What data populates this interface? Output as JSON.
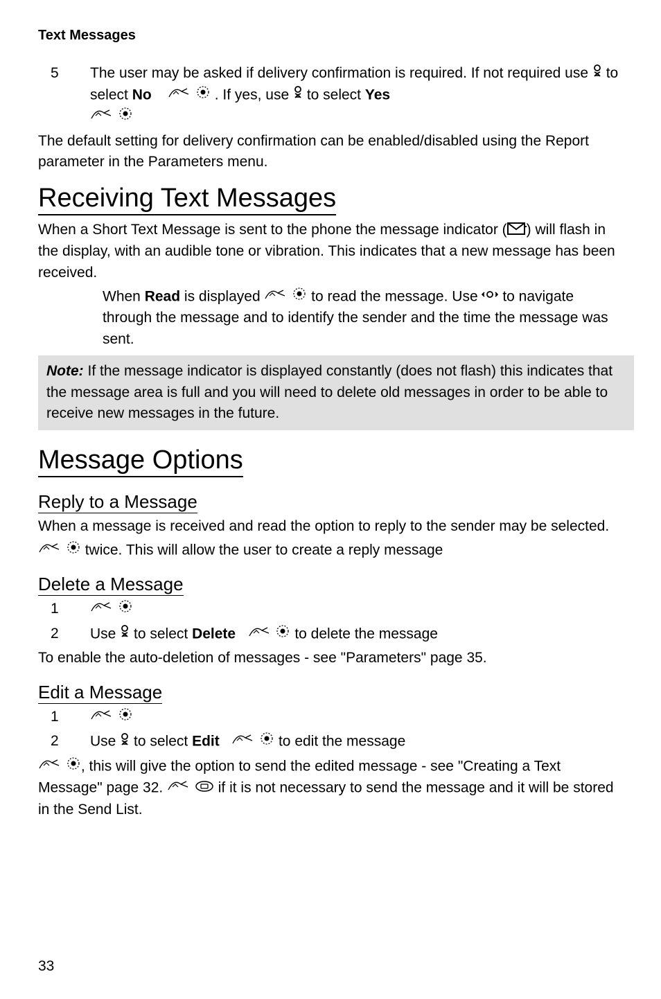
{
  "header": "Text Messages",
  "step5": {
    "num": "5",
    "text1": "The user may be asked if delivery confirmation is required. If not required use ",
    "text2": " to select ",
    "no": "No",
    "text3": ". If yes, use ",
    "text4": " to select ",
    "yes": "Yes"
  },
  "default_setting": "The default setting for delivery confirmation can be enabled/disabled using the Report parameter in the Parameters menu.",
  "h1_receiving": "Receiving Text Messages",
  "receiving": {
    "p1a": "When a Short Text Message is sent to the phone the message indicator (",
    "p1b": ") will flash in the display, with an audible tone or vibration. This indicates that a new message has been received.",
    "p2a": "When ",
    "read": "Read",
    "p2b": " is displayed ",
    "p2c": " to read the message. Use ",
    "p2d": " to navigate through the message and to identify the sender and the time the message was sent."
  },
  "note": {
    "label": "Note:",
    "text": " If the message indicator is displayed constantly (does not flash) this indicates that the message area is full and you will need to delete old messages in order to be able to receive new messages in the future."
  },
  "h1_options": "Message Options",
  "h2_reply": "Reply to a Message",
  "reply": {
    "p1": "When a message is received and read the option to reply to the sender may be selected.",
    "p2": " twice. This will allow the user to create a reply message"
  },
  "h2_delete": "Delete a Message",
  "delete": {
    "s1": "1",
    "s2": "2",
    "s2a": "Use ",
    "s2b": " to select ",
    "del": "Delete",
    "s2c": " to delete the message",
    "after": "To enable the auto-deletion of messages - see \"Parameters\" page 35."
  },
  "h2_edit": "Edit a Message",
  "edit": {
    "s1": "1",
    "s2": "2",
    "s2a": "Use ",
    "s2b": " to select ",
    "ed": "Edit",
    "s2c": " to edit the message",
    "aftera": ", this will give the option to send the edited message - see \"Creating a Text Message\" page 32. ",
    "afterb": " if it is not necessary to send the message and it will be stored in the Send List."
  },
  "page": "33"
}
